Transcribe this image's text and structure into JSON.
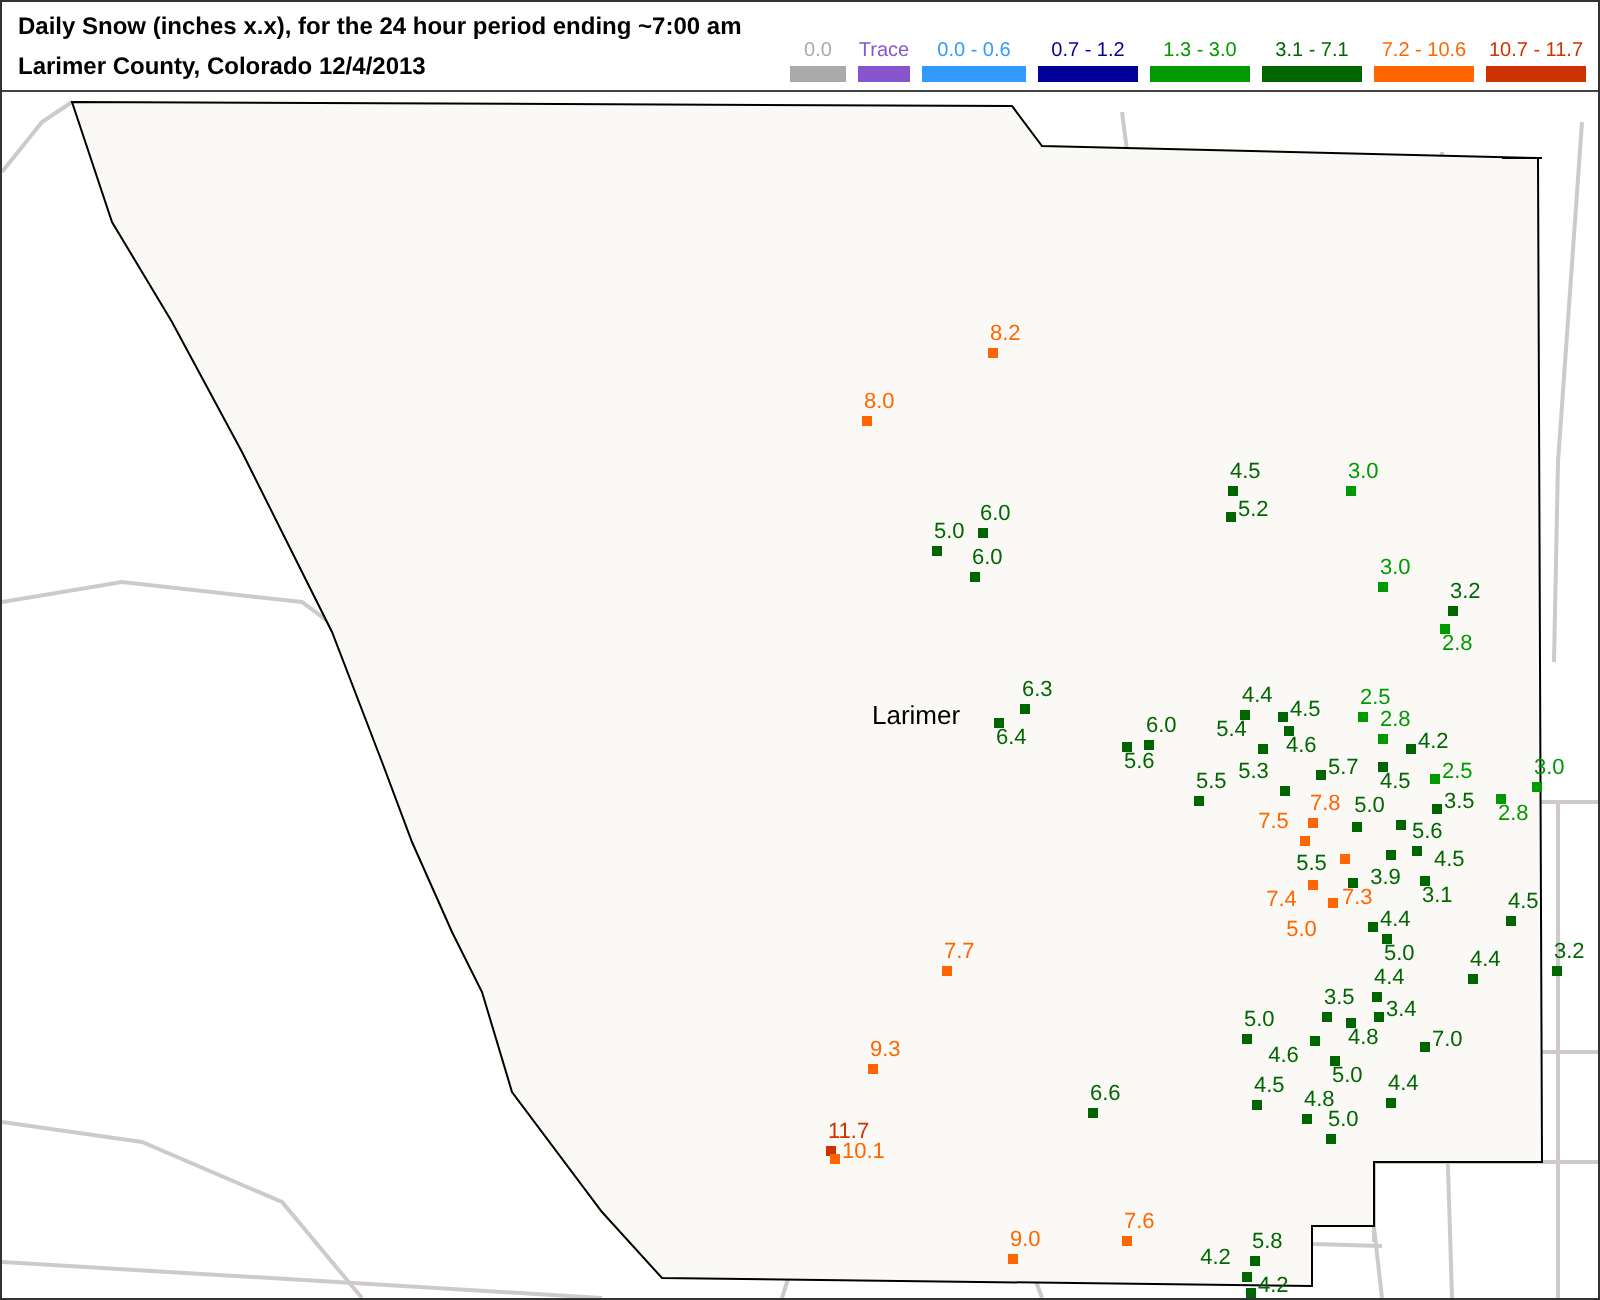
{
  "header": {
    "title": "Daily Snow (inches  x.x),  for the 24 hour period ending ~7:00 am",
    "subtitle": "Larimer County, Colorado  12/4/2013"
  },
  "legend": [
    {
      "label": "0.0",
      "color": "#aaaaaa"
    },
    {
      "label": "Trace",
      "color": "#8855cc"
    },
    {
      "label": "0.0 - 0.6",
      "color": "#3399ff"
    },
    {
      "label": "0.7 - 1.2",
      "color": "#000099"
    },
    {
      "label": "1.3 - 3.0",
      "color": "#009900"
    },
    {
      "label": "3.1 - 7.1",
      "color": "#006600"
    },
    {
      "label": "7.2 - 10.6",
      "color": "#ff6600"
    },
    {
      "label": "10.7 - 11.7",
      "color": "#cc3300"
    }
  ],
  "map": {
    "county_label": "Larimer",
    "stations": [
      {
        "value": "8.2",
        "color": "#ff6600"
      },
      {
        "value": "8.0",
        "color": "#ff6600"
      },
      {
        "value": "4.5",
        "color": "#006600"
      },
      {
        "value": "3.0",
        "color": "#009900"
      },
      {
        "value": "5.2",
        "color": "#006600"
      },
      {
        "value": "6.0",
        "color": "#006600"
      },
      {
        "value": "5.0",
        "color": "#006600"
      },
      {
        "value": "6.0",
        "color": "#006600"
      },
      {
        "value": "3.0",
        "color": "#009900"
      },
      {
        "value": "3.2",
        "color": "#006600"
      },
      {
        "value": "2.8",
        "color": "#009900"
      },
      {
        "value": "6.3",
        "color": "#006600"
      },
      {
        "value": "4.4",
        "color": "#006600"
      },
      {
        "value": "4.5",
        "color": "#006600"
      },
      {
        "value": "2.5",
        "color": "#009900"
      },
      {
        "value": "6.4",
        "color": "#006600"
      },
      {
        "value": "5.6",
        "color": "#006600"
      },
      {
        "value": "6.0",
        "color": "#006600"
      },
      {
        "value": "4.6",
        "color": "#006600"
      },
      {
        "value": "2.8",
        "color": "#009900"
      },
      {
        "value": "5.4",
        "color": "#006600"
      },
      {
        "value": "4.2",
        "color": "#006600"
      },
      {
        "value": "5.3",
        "color": "#006600"
      },
      {
        "value": "5.7",
        "color": "#006600"
      },
      {
        "value": "4.5",
        "color": "#006600"
      },
      {
        "value": "2.5",
        "color": "#009900"
      },
      {
        "value": "3.0",
        "color": "#009900"
      },
      {
        "value": "5.5",
        "color": "#006600"
      },
      {
        "value": "7.8",
        "color": "#ff6600"
      },
      {
        "value": "5.0",
        "color": "#006600"
      },
      {
        "value": "3.5",
        "color": "#006600"
      },
      {
        "value": "2.8",
        "color": "#009900"
      },
      {
        "value": "5.6",
        "color": "#006600"
      },
      {
        "value": "7.5",
        "color": "#ff6600"
      },
      {
        "value": "3.9",
        "color": "#006600"
      },
      {
        "value": "4.5",
        "color": "#006600"
      },
      {
        "value": "7.3",
        "color": "#ff6600"
      },
      {
        "value": "3.1",
        "color": "#006600"
      },
      {
        "value": "5.5",
        "color": "#006600"
      },
      {
        "value": "7.4",
        "color": "#ff6600"
      },
      {
        "value": "5.0",
        "color": "#ff6600"
      },
      {
        "value": "4.5",
        "color": "#006600"
      },
      {
        "value": "4.4",
        "color": "#006600"
      },
      {
        "value": "7.7",
        "color": "#ff6600"
      },
      {
        "value": "5.0",
        "color": "#006600"
      },
      {
        "value": "3.2",
        "color": "#006600"
      },
      {
        "value": "4.4",
        "color": "#006600"
      },
      {
        "value": "4.4",
        "color": "#006600"
      },
      {
        "value": "3.5",
        "color": "#006600"
      },
      {
        "value": "3.4",
        "color": "#006600"
      },
      {
        "value": "4.8",
        "color": "#006600"
      },
      {
        "value": "5.0",
        "color": "#006600"
      },
      {
        "value": "9.3",
        "color": "#ff6600"
      },
      {
        "value": "4.6",
        "color": "#006600"
      },
      {
        "value": "7.0",
        "color": "#006600"
      },
      {
        "value": "5.0",
        "color": "#006600"
      },
      {
        "value": "6.6",
        "color": "#006600"
      },
      {
        "value": "4.5",
        "color": "#006600"
      },
      {
        "value": "4.4",
        "color": "#006600"
      },
      {
        "value": "4.8",
        "color": "#006600"
      },
      {
        "value": "5.0",
        "color": "#006600"
      },
      {
        "value": "11.7",
        "color": "#cc3300"
      },
      {
        "value": "10.1",
        "color": "#ff6600"
      },
      {
        "value": "7.6",
        "color": "#ff6600"
      },
      {
        "value": "9.0",
        "color": "#ff6600"
      },
      {
        "value": "5.8",
        "color": "#006600"
      },
      {
        "value": "4.2",
        "color": "#006600"
      },
      {
        "value": "4.2",
        "color": "#006600"
      }
    ]
  }
}
